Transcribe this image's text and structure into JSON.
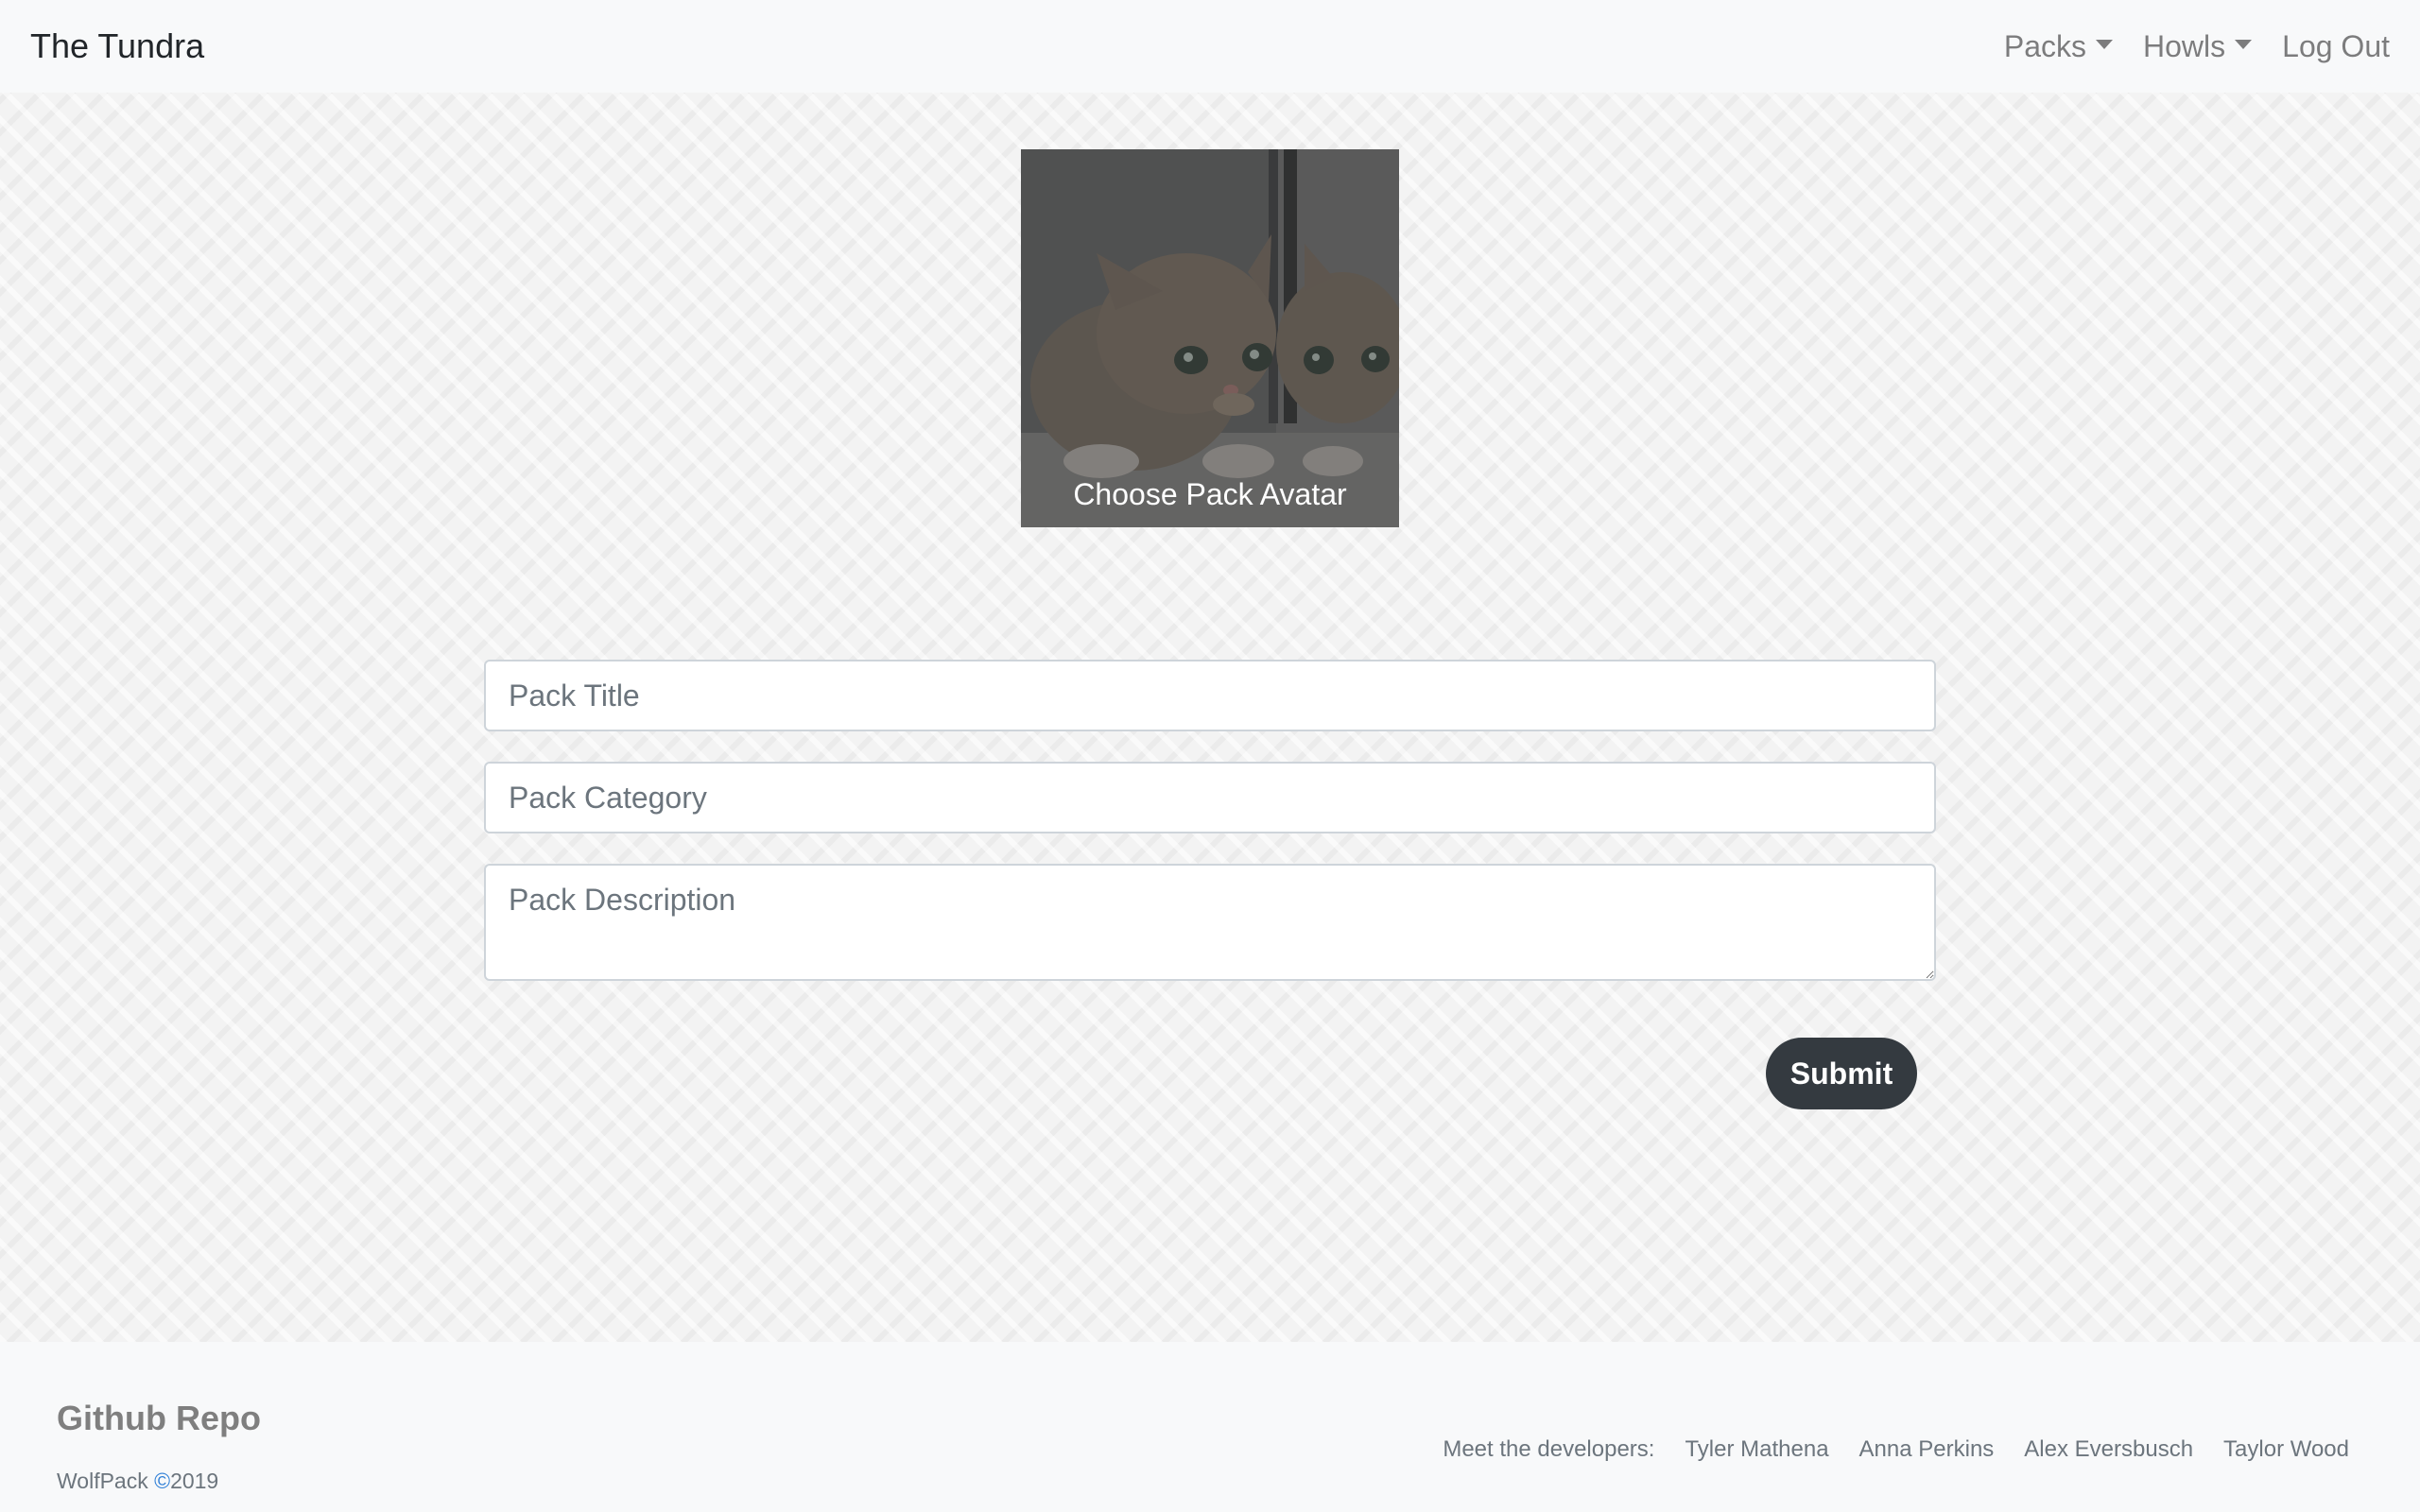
{
  "navbar": {
    "brand": "The Tundra",
    "links": [
      {
        "label": "Packs",
        "dropdown": true
      },
      {
        "label": "Howls",
        "dropdown": true
      },
      {
        "label": "Log Out",
        "dropdown": false
      }
    ]
  },
  "form": {
    "avatar_label": "Choose Pack Avatar",
    "title_placeholder": "Pack Title",
    "category_placeholder": "Pack Category",
    "description_placeholder": "Pack Description",
    "submit_label": "Submit"
  },
  "footer": {
    "repo_link": "Github Repo",
    "copyright_name": "WolfPack ",
    "copyright_symbol": "©",
    "copyright_year": "2019",
    "developers_label": "Meet the developers:",
    "developers": [
      "Tyler Mathena",
      "Anna Perkins",
      "Alex Eversbusch",
      "Taylor Wood"
    ]
  },
  "colors": {
    "navbar_bg": "#f8f9fa",
    "submit_bg": "#343a40",
    "link_accent": "#2f7fd6"
  }
}
